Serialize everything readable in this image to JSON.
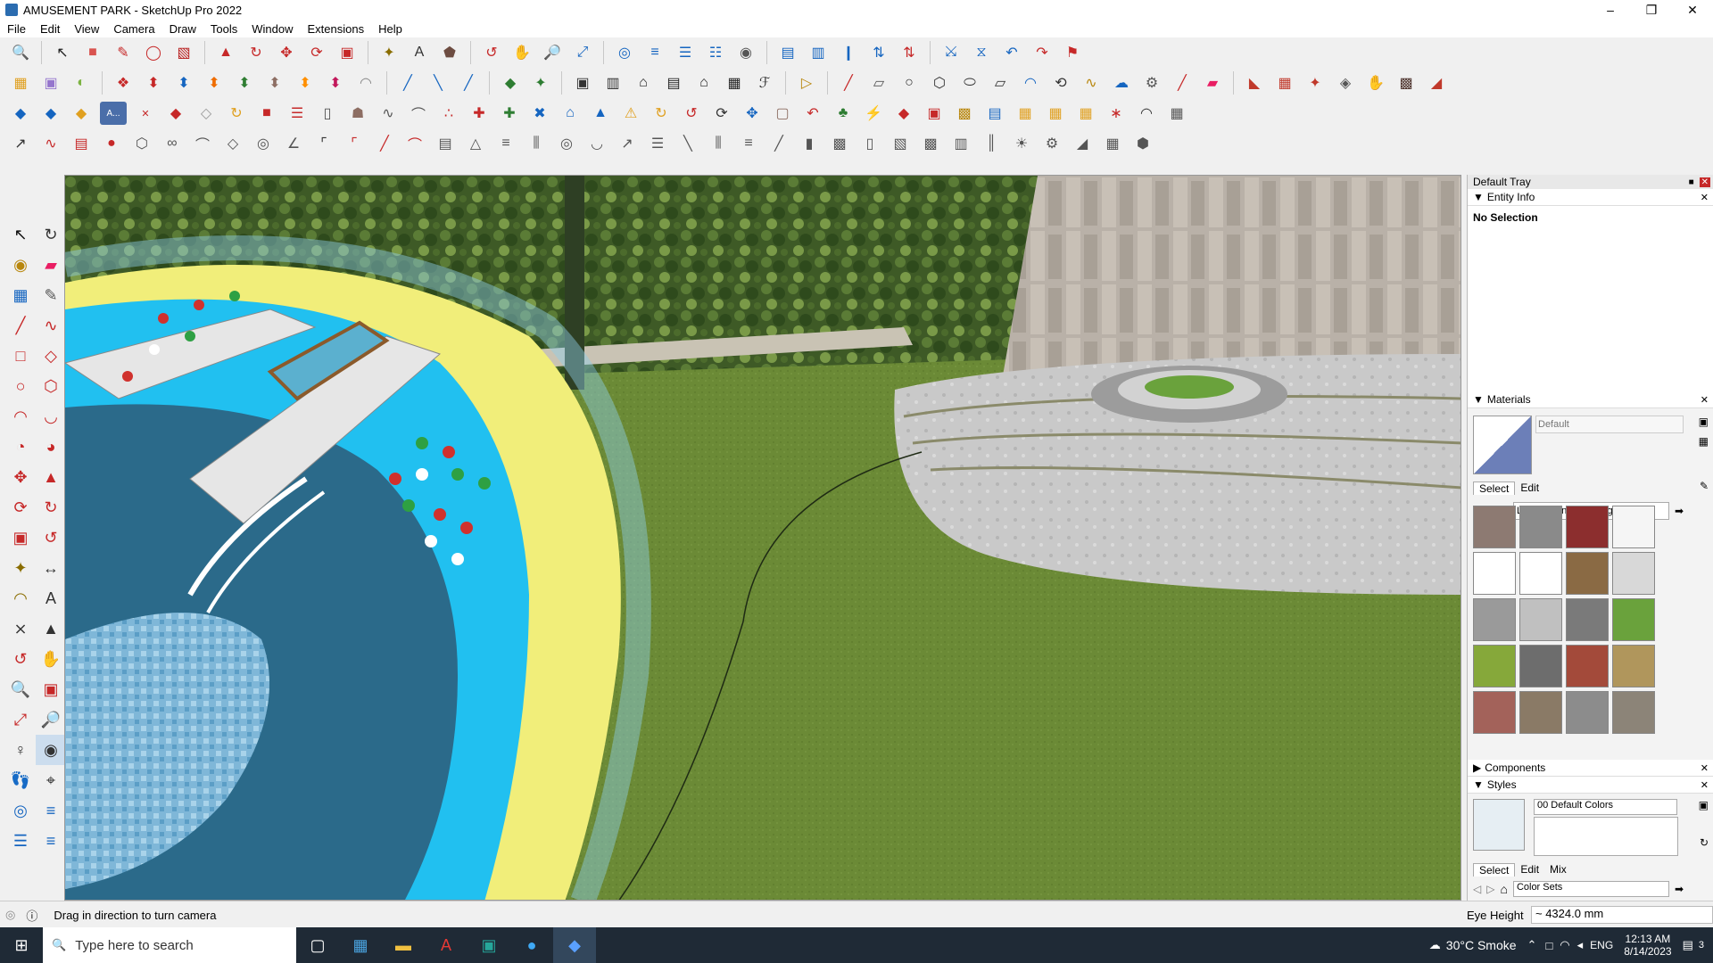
{
  "window": {
    "title": "AMUSEMENT PARK - SketchUp Pro 2022"
  },
  "menu": [
    "File",
    "Edit",
    "View",
    "Camera",
    "Draw",
    "Tools",
    "Window",
    "Extensions",
    "Help"
  ],
  "toolbar_rows": [
    [
      "zoom-icon",
      "select-icon",
      "eraser-icon",
      "pencil-icon",
      "lasso-icon",
      "paint-icon",
      "push-pull-icon",
      "follow-me-icon",
      "move-icon",
      "rotate-icon",
      "scale-icon",
      "tape-icon",
      "text-icon",
      "paint-bucket-icon",
      "orbit-icon",
      "pan-icon",
      "zoom-window-icon",
      "zoom-extents-icon",
      "section-icon",
      "layers-icon",
      "styles-icon",
      "components-icon",
      "geo-icon",
      "camera-icon",
      "export-icon",
      "arrow-up-icon",
      "arrow-down-icon",
      "flip-icon",
      "undo-icon",
      "redo-icon",
      "hide-icon"
    ],
    [
      "box-icon",
      "cube-icon",
      "sphere-icon",
      "extrude-icon",
      "arrow-red",
      "arrow-blue",
      "arrow-orange",
      "arrow-green",
      "arrow-brown",
      "arrow-orange2",
      "arrow-magenta",
      "arc-icon",
      "wall-icon",
      "window-icon",
      "house-icon",
      "roof-icon",
      "garage-icon",
      "label-icon",
      "pencil-icon",
      "shape-icons",
      "paint-icon"
    ],
    [
      "sandbox-icon",
      "terrain-icon",
      "stamp-icon",
      "drape-icon",
      "chair-icon",
      "spring-icon",
      "cut-icon",
      "dot-icon",
      "wood-icon",
      "light-icon",
      "tree-icon"
    ],
    [
      "measure-icon",
      "protractor-icon",
      "axes-icon",
      "dimension-icon",
      "section-fill-icon",
      "orbit-icon",
      "walk-icon",
      "look-around-icon",
      "position-camera-icon"
    ]
  ],
  "tray": {
    "title": "Default Tray",
    "entity_info": {
      "header": "Entity Info",
      "value": "No Selection"
    },
    "materials": {
      "header": "Materials",
      "name_placeholder": "Default",
      "tabs": [
        "Select",
        "Edit"
      ],
      "library": "Landscaping, Fencing and V"
    },
    "components": {
      "header": "Components"
    },
    "styles": {
      "header": "Styles",
      "style_name": "00  Default Colors",
      "tabs": [
        "Select",
        "Edit",
        "Mix"
      ],
      "library": "Color Sets"
    }
  },
  "status": {
    "message": "Drag in direction to turn camera",
    "measure_label": "Eye Height",
    "measure_value": "~ 4324.0 mm"
  },
  "taskbar": {
    "search_placeholder": "Type here to search",
    "weather": "30°C  Smoke",
    "language": "ENG",
    "time": "12:13 AM",
    "date": "8/14/2023",
    "notifications": "3"
  },
  "swatches": [
    "#8d7a72",
    "#8a8a8a",
    "#8c2e2e",
    "#f5f5f5",
    "#ffffff",
    "#ffffff",
    "#8a6a44",
    "#d8d8d8",
    "#9a9a9a",
    "#c0c0c0",
    "#7a7a7a",
    "#6aa23c",
    "#86a83a",
    "#6d6d6d",
    "#a34a3a",
    "#b0965c",
    "#a3625a",
    "#8a7a66",
    "#8c8c8c",
    "#8c8478"
  ],
  "colors": {
    "grass": "#6b8a36",
    "pool": "#2b7ea8",
    "deck": "#f1ee7a",
    "tray_bg": "#f3f3f3"
  }
}
